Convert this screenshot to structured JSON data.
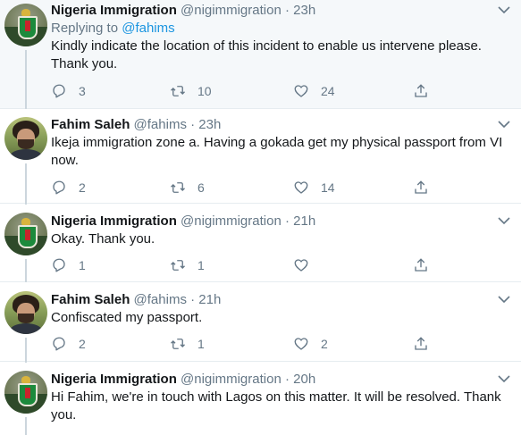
{
  "tweets": [
    {
      "name": "Nigeria Immigration",
      "handle": "@nigimmigration",
      "time": "23h",
      "reply_prefix": "Replying to ",
      "reply_mention": "@fahims",
      "text": "Kindly indicate the location of this incident to enable us intervene please. Thank you.",
      "replies": "3",
      "retweets": "10",
      "likes": "24"
    },
    {
      "name": "Fahim Saleh",
      "handle": "@fahims",
      "time": "23h",
      "text": "Ikeja immigration zone a. Having a gokada get my physical passport from VI now.",
      "replies": "2",
      "retweets": "6",
      "likes": "14"
    },
    {
      "name": "Nigeria Immigration",
      "handle": "@nigimmigration",
      "time": "21h",
      "text": "Okay. Thank you.",
      "replies": "1",
      "retweets": "1",
      "likes": ""
    },
    {
      "name": "Fahim Saleh",
      "handle": "@fahims",
      "time": "21h",
      "text": "Confiscated my passport.",
      "replies": "2",
      "retweets": "1",
      "likes": "2"
    },
    {
      "name": "Nigeria Immigration",
      "handle": "@nigimmigration",
      "time": "20h",
      "text": "Hi Fahim, we're in touch with Lagos on this matter. It will be resolved. Thank you."
    }
  ],
  "separator": "·",
  "icons": {
    "reply": "reply-icon",
    "retweet": "retweet-icon",
    "like": "heart-icon",
    "share": "share-icon",
    "more": "chevron-down-icon"
  },
  "colors": {
    "link": "#1b95e0",
    "secondary": "#657786",
    "highlight_bg": "#f5f8fa"
  }
}
